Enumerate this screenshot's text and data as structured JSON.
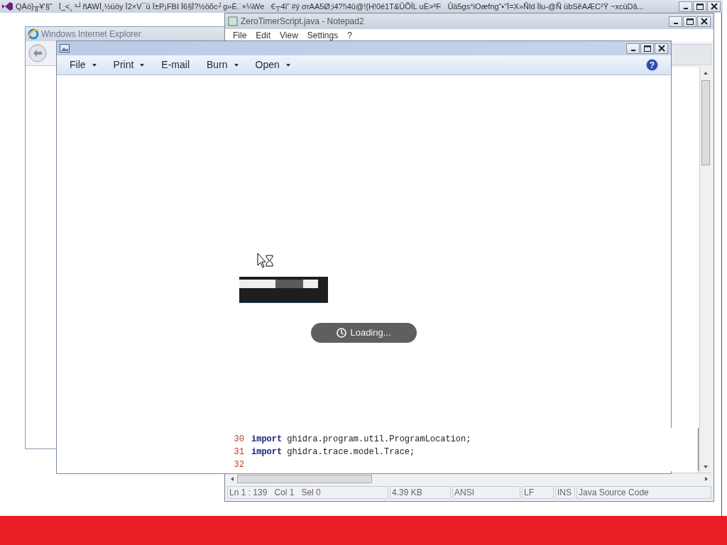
{
  "top_window": {
    "title": "QÀö}╥¥'§˜   Ī_<¸ ˢ┘ñAWĪ¸½üöy Ī2×V¯ü Ī±P¡FBI Ī6§Ī?½öõc┘g»È.˙×¼We   €┬4î'˙#ý σrAA5Ø;i4?!\\4û@!{H!0é1T&ÛÕÎL uÈ>ºF   Ûä5gs°iOæfng˜•\"Ī=X»Ñld Īlu-@Ñ übSêAÆC²Ÿ ~xcùDâ..."
  },
  "ie_window": {
    "title": "Windows Internet Explorer"
  },
  "notepad": {
    "title": "ZeroTimerScript.java - Notepad2",
    "menu": [
      "File",
      "Edit",
      "View",
      "Settings",
      "?"
    ],
    "code_lines": [
      {
        "number": "30",
        "keyword": "import",
        "text": "ghidra.program.util.ProgramLocation;"
      },
      {
        "number": "31",
        "keyword": "import",
        "text": "ghidra.trace.model.Trace;"
      },
      {
        "number": "32"
      }
    ],
    "status": [
      "Ln 1 : 139   Col 1   Sel 0",
      "4.39 KB",
      "ANSI",
      "LF",
      "INS",
      "Java Source Code"
    ]
  },
  "gallery": {
    "menu": [
      {
        "label": "File",
        "dropdown": true
      },
      {
        "label": "Print",
        "dropdown": true
      },
      {
        "label": "E-mail",
        "dropdown": false
      },
      {
        "label": "Burn",
        "dropdown": true
      },
      {
        "label": "Open",
        "dropdown": true
      }
    ],
    "help": "?",
    "loading": "Loading..."
  }
}
